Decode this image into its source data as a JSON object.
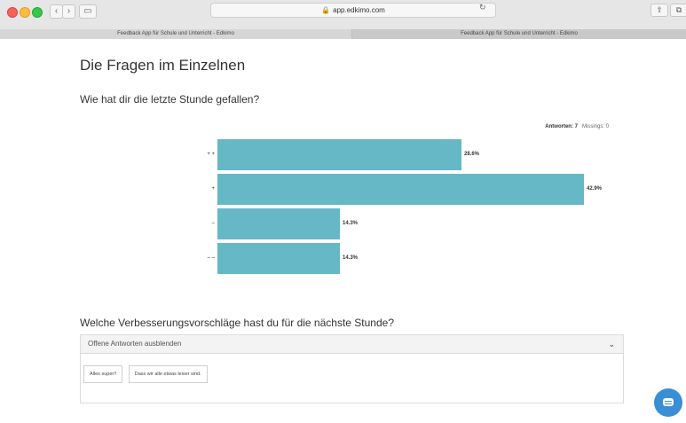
{
  "browser": {
    "address": "app.edkimo.com",
    "tabs": [
      "Feedback App für Schule und Unterricht - Edkimo",
      "Feedback App für Schule und Unterricht - Edkimo"
    ]
  },
  "page": {
    "title": "Die Fragen im Einzelnen",
    "question1": {
      "text": "Wie hat dir die letzte Stunde gefallen?",
      "answers_label": "Antworten: 7",
      "missings_label": "Missings: 0",
      "bars": [
        {
          "label": "+ +",
          "value": 28.6,
          "pct_text": "28.6%"
        },
        {
          "label": "+",
          "value": 42.9,
          "pct_text": "42.9%"
        },
        {
          "label": "–",
          "value": 14.3,
          "pct_text": "14.3%"
        },
        {
          "label": "– –",
          "value": 14.3,
          "pct_text": "14.3%"
        }
      ]
    },
    "question2": {
      "text": "Welche Verbesserungsvorschläge hast du für die nächste Stunde?",
      "toggle_label": "Offene Antworten ausblenden",
      "answers": [
        "Alles super!!",
        "Dass wir alle etwas leiser sind."
      ]
    }
  },
  "colors": {
    "bar": "#66b8c6",
    "chat_button": "#3a8ed6"
  },
  "icons": {
    "chevron": "chevron-down-icon",
    "chat": "chat-icon",
    "lock": "lock-icon"
  }
}
